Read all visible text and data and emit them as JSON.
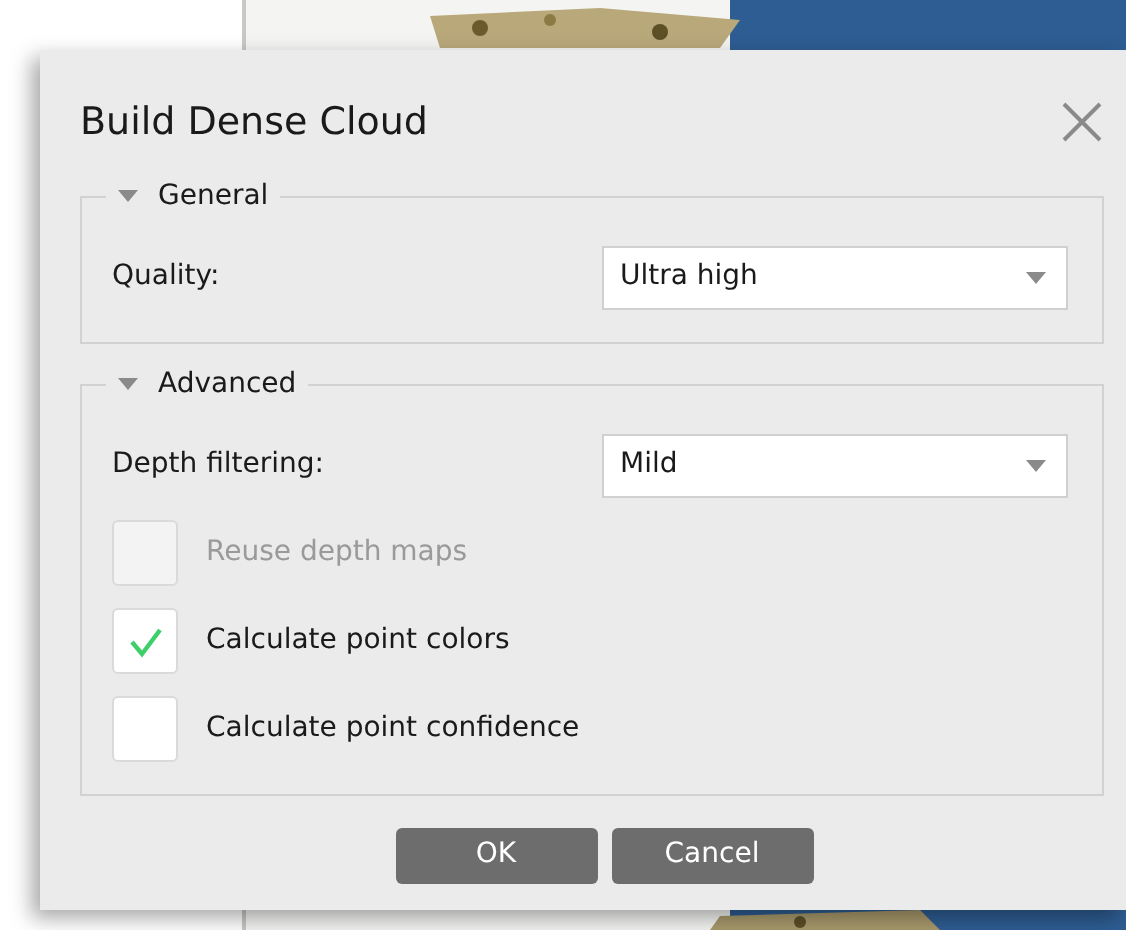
{
  "dialog": {
    "title": "Build Dense Cloud"
  },
  "groups": [
    {
      "title": "General",
      "expanded": true,
      "items": [
        {
          "kind": "select",
          "label": "Quality:",
          "value": "Ultra high"
        }
      ]
    },
    {
      "title": "Advanced",
      "expanded": true,
      "items": [
        {
          "kind": "select",
          "label": "Depth filtering:",
          "value": "Mild"
        },
        {
          "kind": "checkbox",
          "label": "Reuse depth maps",
          "checked": false,
          "disabled": true
        },
        {
          "kind": "checkbox",
          "label": "Calculate point colors",
          "checked": true,
          "disabled": false
        },
        {
          "kind": "checkbox",
          "label": "Calculate point confidence",
          "checked": false,
          "disabled": false
        }
      ]
    }
  ],
  "buttons": [
    "OK",
    "Cancel"
  ]
}
